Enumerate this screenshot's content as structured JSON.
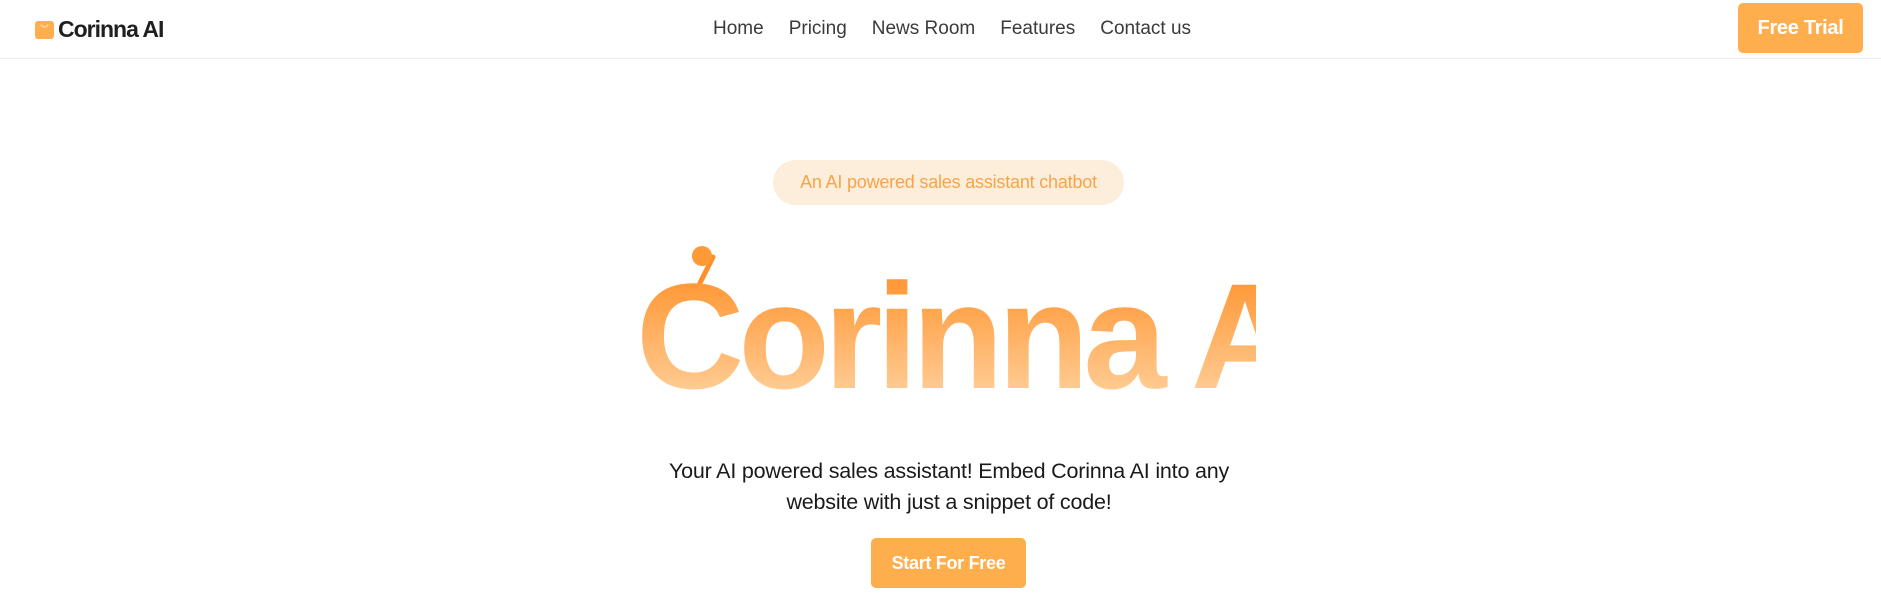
{
  "header": {
    "brand_name": "Corinna AI",
    "brand_icon": "shopping-bag-smile-icon",
    "nav_items": [
      "Home",
      "Pricing",
      "News Room",
      "Features",
      "Contact us"
    ],
    "cta_label": "Free Trial"
  },
  "hero": {
    "tagline": "An AI powered sales assistant chatbot",
    "logo_text": "Corinna AI",
    "description_line1": "Your AI powered sales assistant! Embed Corinna AI into any",
    "description_line2": "website with just a snippet of code!",
    "cta_label": "Start For Free"
  },
  "colors": {
    "accent": "#ffae4e",
    "accent_dark": "#ff7a00",
    "accent_light": "#fde3c2",
    "tagline_bg": "#fdeedb",
    "tagline_text": "#f9a349",
    "text": "#1f1f1f"
  }
}
